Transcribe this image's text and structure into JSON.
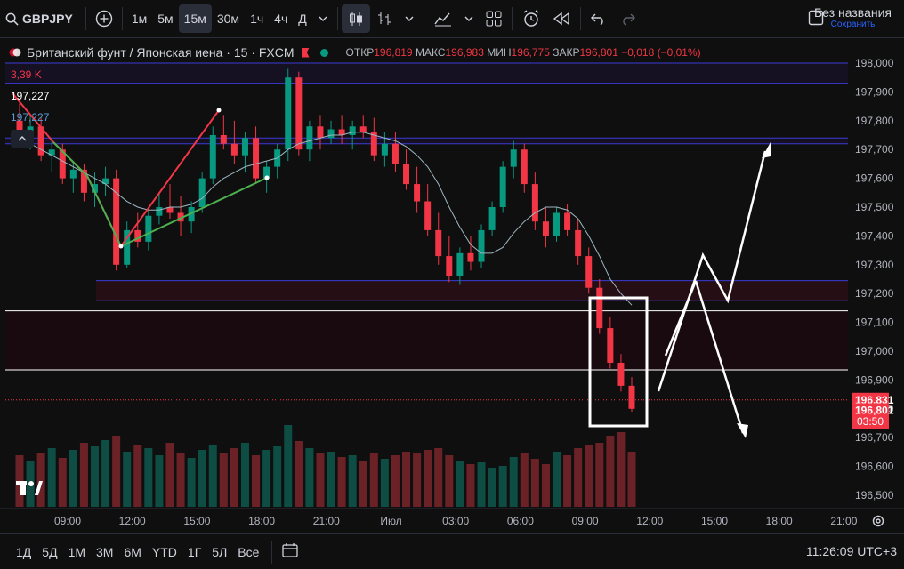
{
  "toolbar": {
    "symbol": "GBPJPY",
    "intervals": [
      "1м",
      "5м",
      "15м",
      "30м",
      "1ч",
      "4ч",
      "Д"
    ],
    "active_interval": "15м",
    "layout_title": "Без названия",
    "layout_subtitle": "Сохранить"
  },
  "legend": {
    "instrument": "Британский фунт / Японская иена · 15 · FXCM",
    "open_label": "ОТКР",
    "open": "196,819",
    "high_label": "МАКС",
    "high": "196,983",
    "low_label": "МИН",
    "low": "196,775",
    "close_label": "ЗАКР",
    "close": "196,801",
    "change": "−0,018 (−0,01%)"
  },
  "indicators": {
    "volume": "3,39 K",
    "price_white": "197,227",
    "price_blue": "197,227"
  },
  "price_axis": {
    "ticks": [
      "198,000",
      "197,900",
      "197,800",
      "197,700",
      "197,600",
      "197,500",
      "197,400",
      "197,300",
      "197,200",
      "197,100",
      "197,000",
      "196,900",
      "196,800",
      "196,700",
      "196,600",
      "196,500"
    ],
    "line_price_label": "196,831",
    "current_price_label": "196,801",
    "countdown": "03:50"
  },
  "time_axis": {
    "ticks": [
      "09:00",
      "12:00",
      "15:00",
      "18:00",
      "21:00",
      "Июл",
      "03:00",
      "06:00",
      "09:00",
      "12:00",
      "15:00",
      "18:00",
      "21:00"
    ]
  },
  "bottom": {
    "ranges": [
      "1Д",
      "5Д",
      "1М",
      "3М",
      "6М",
      "YTD",
      "1Г",
      "5Л",
      "Все"
    ],
    "clock": "11:26:09 UTC+3"
  },
  "colors": {
    "up": "#089981",
    "down": "#f23645",
    "ma": "#9fb6c2",
    "zone_line": "#3b3bd6",
    "arrow": "#ffffff",
    "background": "#0f0f0f"
  },
  "chart_data": {
    "type": "candlestick",
    "symbol": "GBPJPY",
    "ylim": [
      196.45,
      198.05
    ],
    "candles": [
      [
        197.8,
        197.86,
        197.72,
        197.75
      ],
      [
        197.75,
        197.82,
        197.7,
        197.78
      ],
      [
        197.78,
        197.81,
        197.66,
        197.68
      ],
      [
        197.68,
        197.74,
        197.62,
        197.7
      ],
      [
        197.7,
        197.72,
        197.58,
        197.6
      ],
      [
        197.6,
        197.66,
        197.55,
        197.63
      ],
      [
        197.63,
        197.65,
        197.52,
        197.55
      ],
      [
        197.55,
        197.62,
        197.5,
        197.58
      ],
      [
        197.58,
        197.64,
        197.54,
        197.6
      ],
      [
        197.6,
        197.63,
        197.28,
        197.3
      ],
      [
        197.3,
        197.45,
        197.29,
        197.42
      ],
      [
        197.42,
        197.48,
        197.36,
        197.38
      ],
      [
        197.38,
        197.5,
        197.35,
        197.47
      ],
      [
        197.47,
        197.55,
        197.44,
        197.5
      ],
      [
        197.5,
        197.58,
        197.46,
        197.48
      ],
      [
        197.48,
        197.54,
        197.4,
        197.45
      ],
      [
        197.45,
        197.52,
        197.41,
        197.5
      ],
      [
        197.5,
        197.62,
        197.48,
        197.6
      ],
      [
        197.6,
        197.78,
        197.58,
        197.75
      ],
      [
        197.75,
        197.82,
        197.7,
        197.72
      ],
      [
        197.72,
        197.8,
        197.65,
        197.68
      ],
      [
        197.68,
        197.76,
        197.62,
        197.74
      ],
      [
        197.74,
        197.78,
        197.58,
        197.6
      ],
      [
        197.6,
        197.66,
        197.55,
        197.64
      ],
      [
        197.64,
        197.72,
        197.6,
        197.7
      ],
      [
        197.7,
        197.98,
        197.66,
        197.95
      ],
      [
        197.95,
        197.97,
        197.68,
        197.7
      ],
      [
        197.7,
        197.8,
        197.66,
        197.78
      ],
      [
        197.78,
        197.82,
        197.7,
        197.74
      ],
      [
        197.74,
        197.8,
        197.72,
        197.77
      ],
      [
        197.77,
        197.82,
        197.72,
        197.75
      ],
      [
        197.75,
        197.8,
        197.7,
        197.78
      ],
      [
        197.78,
        197.82,
        197.74,
        197.76
      ],
      [
        197.76,
        197.81,
        197.66,
        197.68
      ],
      [
        197.68,
        197.76,
        197.64,
        197.72
      ],
      [
        197.72,
        197.76,
        197.62,
        197.65
      ],
      [
        197.65,
        197.7,
        197.56,
        197.58
      ],
      [
        197.58,
        197.64,
        197.48,
        197.52
      ],
      [
        197.52,
        197.58,
        197.4,
        197.42
      ],
      [
        197.42,
        197.48,
        197.3,
        197.33
      ],
      [
        197.33,
        197.4,
        197.24,
        197.26
      ],
      [
        197.26,
        197.36,
        197.23,
        197.34
      ],
      [
        197.34,
        197.4,
        197.28,
        197.31
      ],
      [
        197.31,
        197.44,
        197.29,
        197.42
      ],
      [
        197.42,
        197.52,
        197.4,
        197.5
      ],
      [
        197.5,
        197.66,
        197.48,
        197.64
      ],
      [
        197.64,
        197.73,
        197.6,
        197.7
      ],
      [
        197.7,
        197.72,
        197.55,
        197.58
      ],
      [
        197.58,
        197.62,
        197.42,
        197.45
      ],
      [
        197.45,
        197.5,
        197.36,
        197.4
      ],
      [
        197.4,
        197.5,
        197.38,
        197.48
      ],
      [
        197.48,
        197.51,
        197.4,
        197.42
      ],
      [
        197.42,
        197.46,
        197.3,
        197.33
      ],
      [
        197.33,
        197.36,
        197.2,
        197.22
      ],
      [
        197.22,
        197.25,
        197.06,
        197.08
      ],
      [
        197.08,
        197.12,
        196.94,
        196.96
      ],
      [
        196.96,
        196.99,
        196.86,
        196.88
      ],
      [
        196.88,
        196.91,
        196.79,
        196.8
      ]
    ],
    "volume": [
      58,
      52,
      61,
      66,
      55,
      64,
      72,
      68,
      75,
      80,
      62,
      70,
      66,
      58,
      72,
      60,
      55,
      64,
      70,
      60,
      66,
      72,
      58,
      64,
      68,
      92,
      74,
      66,
      60,
      62,
      56,
      58,
      52,
      60,
      54,
      58,
      62,
      60,
      64,
      66,
      58,
      52,
      48,
      50,
      44,
      46,
      56,
      60,
      54,
      48,
      62,
      58,
      66,
      70,
      72,
      80,
      84,
      62
    ],
    "moving_average": [
      197.74,
      197.72,
      197.7,
      197.68,
      197.66,
      197.64,
      197.62,
      197.6,
      197.58,
      197.55,
      197.52,
      197.5,
      197.49,
      197.49,
      197.5,
      197.5,
      197.51,
      197.53,
      197.57,
      197.6,
      197.62,
      197.64,
      197.65,
      197.66,
      197.67,
      197.7,
      197.72,
      197.73,
      197.74,
      197.75,
      197.75,
      197.76,
      197.76,
      197.75,
      197.74,
      197.73,
      197.71,
      197.68,
      197.64,
      197.58,
      197.5,
      197.43,
      197.37,
      197.34,
      197.34,
      197.36,
      197.41,
      197.45,
      197.48,
      197.5,
      197.5,
      197.49,
      197.46,
      197.4,
      197.33,
      197.25,
      197.2,
      197.16
    ],
    "horizontal_levels": [
      {
        "price": 198.0,
        "kind": "zone"
      },
      {
        "price": 197.93,
        "kind": "zone"
      },
      {
        "price": 197.74,
        "kind": "zone"
      },
      {
        "price": 197.72,
        "kind": "zone"
      },
      {
        "price": 197.245,
        "kind": "zone"
      },
      {
        "price": 197.175,
        "kind": "zone"
      },
      {
        "price": 197.14,
        "kind": "level"
      },
      {
        "price": 196.935,
        "kind": "level"
      },
      {
        "price": 196.831,
        "kind": "price-line"
      }
    ]
  }
}
